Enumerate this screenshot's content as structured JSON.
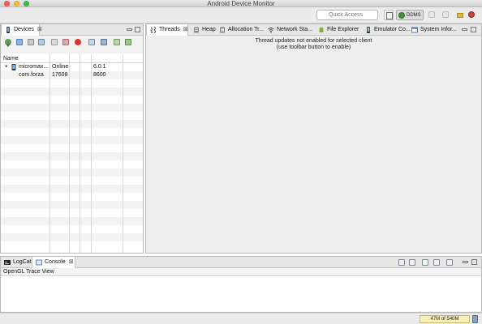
{
  "window": {
    "title": "Android Device Monitor"
  },
  "toolbar": {
    "quick_access_placeholder": "Quick Access",
    "perspective_label": "DDMS"
  },
  "devices_panel": {
    "tab_label": "Devices",
    "columns": [
      "Name",
      "",
      "",
      "",
      ""
    ],
    "rows": [
      {
        "name": "micromax...",
        "status": "Online",
        "port": "",
        "version": "6.0.1",
        "icon": "phone-icon",
        "expanded": true
      },
      {
        "name": "com.forza",
        "status": "17608",
        "port": "",
        "version": "8600"
      }
    ]
  },
  "tabs": {
    "threads": "Threads",
    "heap": "Heap",
    "allocation": "Allocation Tr...",
    "network": "Network Sta...",
    "file_explorer": "File Explorer",
    "emulator": "Emulator Co...",
    "system_info": "System Infor..."
  },
  "threads_panel": {
    "message_line1": "Thread updates not enabled for selected client",
    "message_line2": "(use toolbar button to enable)"
  },
  "bottom_panel": {
    "logcat_tab": "LogCat",
    "console_tab": "Console",
    "console_title": "OpenGL Trace View"
  },
  "status_bar": {
    "heap_usage": "47M of 540M"
  },
  "colors": {
    "accent_green": "#4a8f3a",
    "threads_bg": "#eeeeee",
    "heap_bg": "#f6efb6"
  }
}
